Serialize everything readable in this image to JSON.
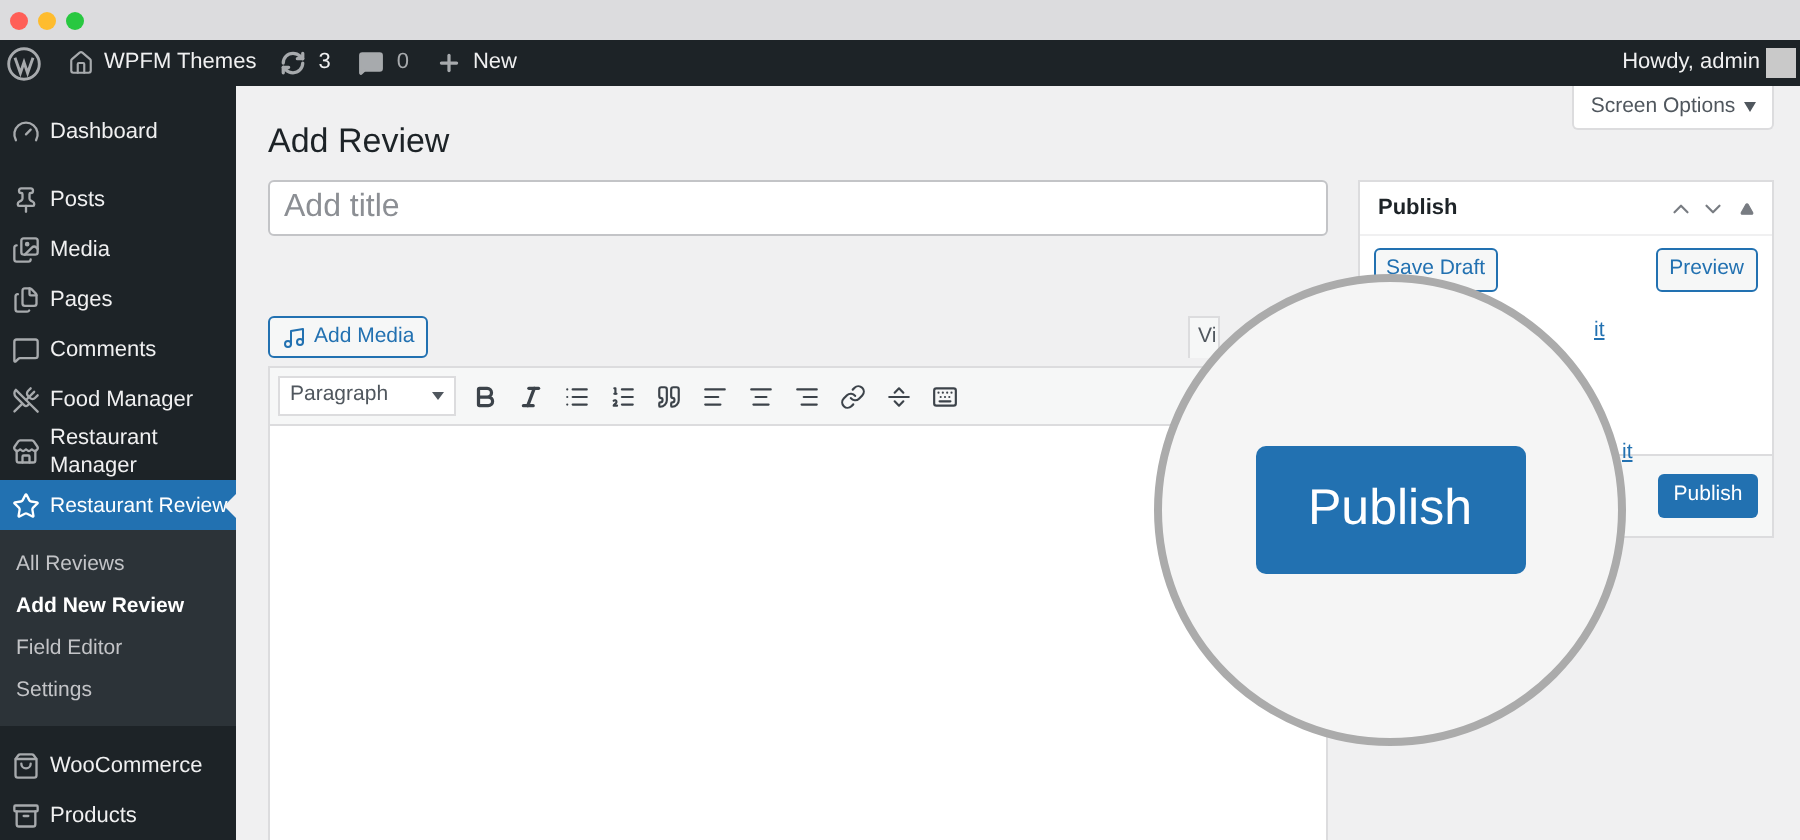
{
  "admin_bar": {
    "site_name": "WPFM Themes",
    "updates": "3",
    "comments": "0",
    "new": "New",
    "greeting": "Howdy, admin"
  },
  "sidebar": {
    "items": [
      {
        "label": "Dashboard",
        "selected": false
      },
      {
        "label": "Posts",
        "selected": false
      },
      {
        "label": "Media",
        "selected": false
      },
      {
        "label": "Pages",
        "selected": false
      },
      {
        "label": "Comments",
        "selected": false
      },
      {
        "label": "Food Manager",
        "selected": false
      },
      {
        "label": "Restaurant Manager",
        "selected": false
      },
      {
        "label": "Restaurant Review",
        "selected": true,
        "children": [
          {
            "label": "All Reviews",
            "selected": false
          },
          {
            "label": "Add New Review",
            "selected": true
          },
          {
            "label": "Field Editor",
            "selected": false
          },
          {
            "label": "Settings",
            "selected": false
          }
        ]
      },
      {
        "label": "WooCommerce",
        "selected": false
      },
      {
        "label": "Products",
        "selected": false
      }
    ]
  },
  "screen_options": "Screen Options",
  "page_title": "Add Review",
  "title_field": {
    "placeholder": "Add title"
  },
  "add_media": "Add Media",
  "editor_tab": "Vi",
  "format_select": "Paragraph",
  "publish_box": {
    "title": "Publish",
    "save_draft": "Save Draft",
    "preview": "Preview",
    "links": [
      "it",
      "it"
    ],
    "publish": "Publish"
  },
  "magnifier": {
    "button": "Publish"
  }
}
